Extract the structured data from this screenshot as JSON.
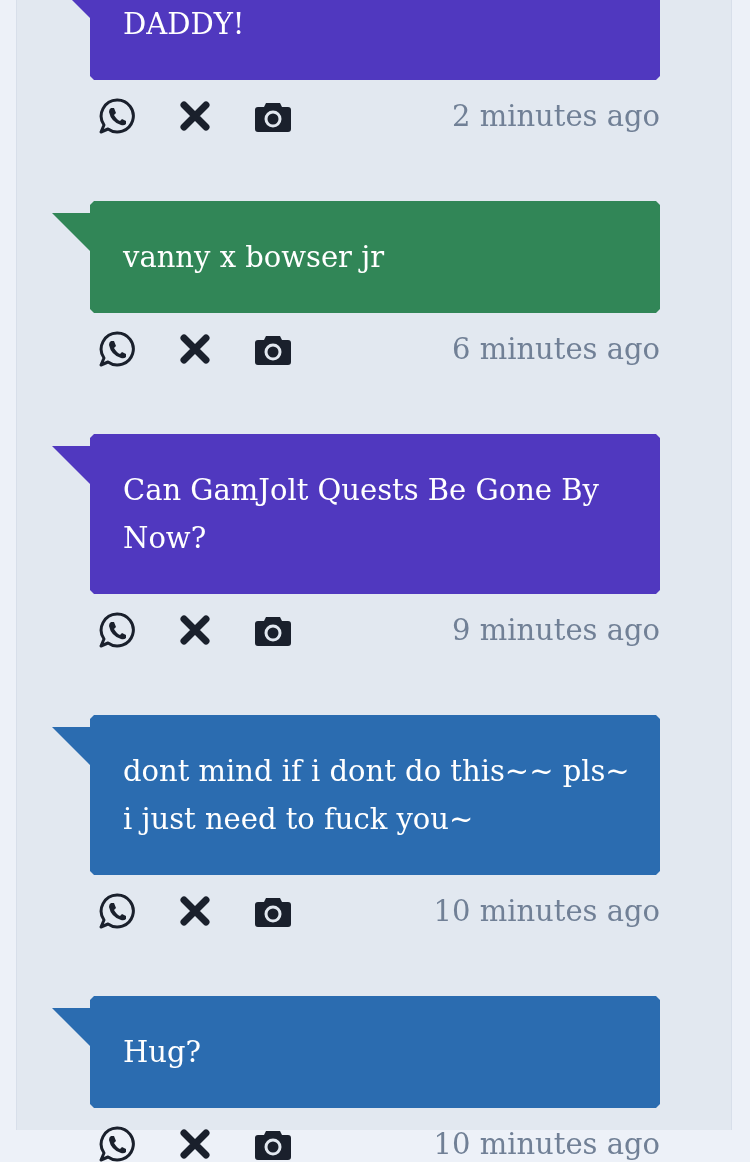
{
  "messages": [
    {
      "text": "DADDY!",
      "color": "#5038bf",
      "time": "2 minutes ago"
    },
    {
      "text": "vanny x bowser jr",
      "color": "#318657",
      "time": "6 minutes ago"
    },
    {
      "text": "Can GamJolt Quests Be Gone By Now?",
      "color": "#5038bf",
      "time": "9 minutes ago"
    },
    {
      "text": "dont mind if i dont do this~~ pls~ i just need to fuck you~",
      "color": "#2b6cb0",
      "time": "10 minutes ago"
    },
    {
      "text": "Hug?",
      "color": "#2b6cb0",
      "time": "10 minutes ago"
    }
  ]
}
